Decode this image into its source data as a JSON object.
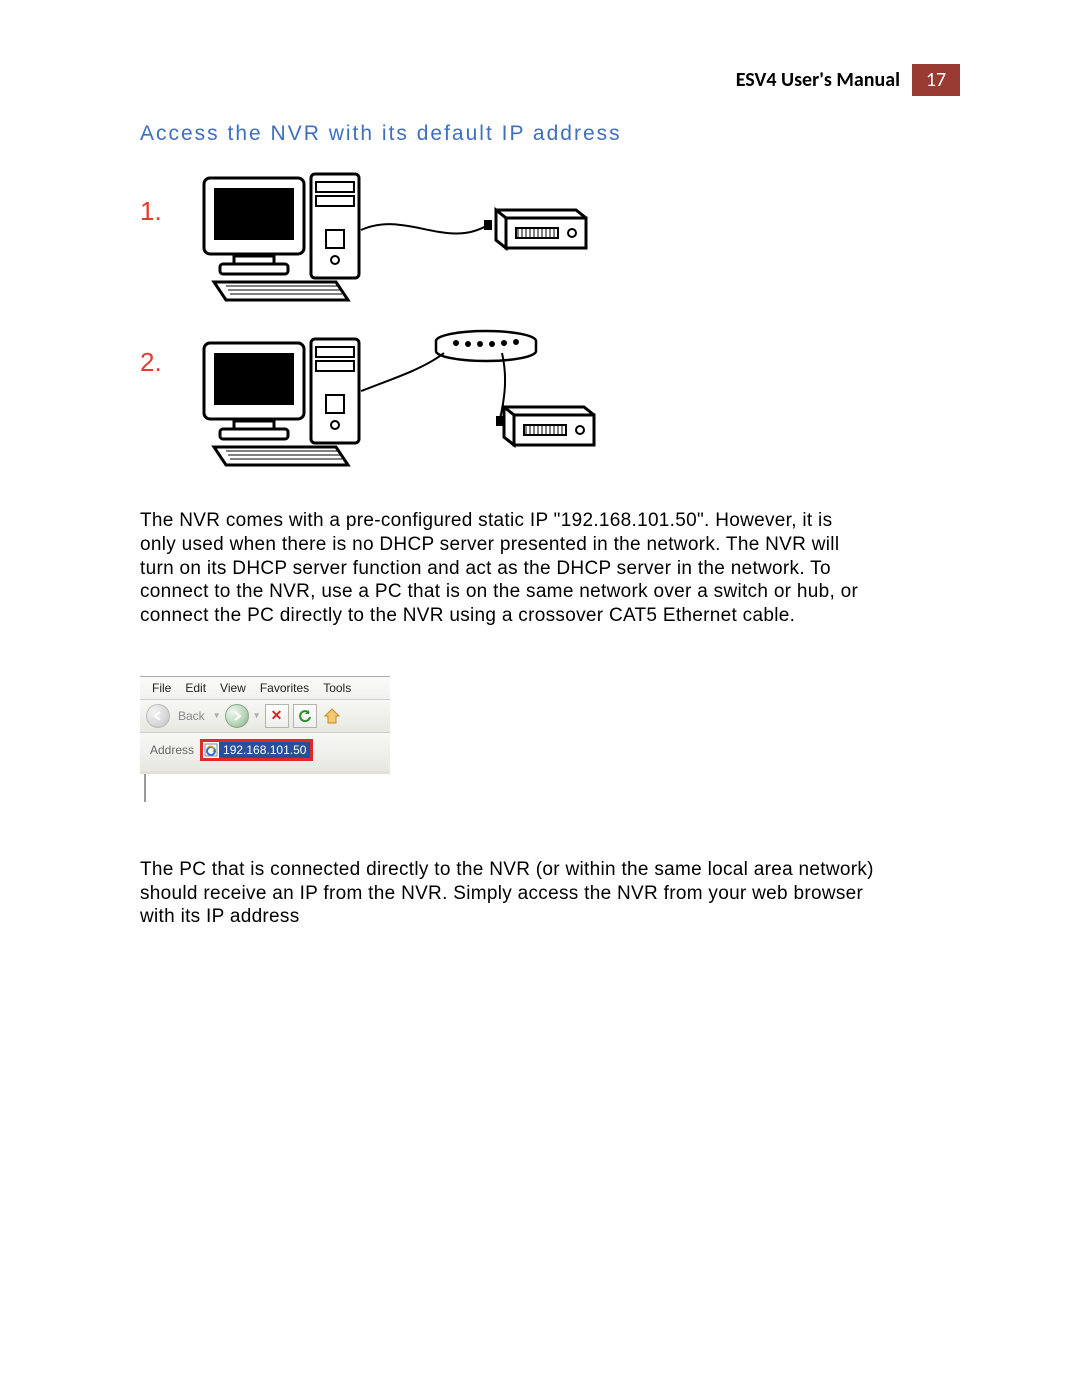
{
  "header": {
    "title": "ESV4 User's Manual",
    "page_number": "17"
  },
  "section_heading": "Access the NVR with its default IP address",
  "diagram_numbers": [
    "1.",
    "2."
  ],
  "paragraph1": "The NVR comes with a pre-configured static IP \"192.168.101.50\". However, it is only used when there is no DHCP server presented in the network. The NVR will turn on its DHCP server function and act as the DHCP server in the network. To connect to the NVR, use a PC that is on the same network over a switch or hub, or connect the PC directly to the NVR using a crossover CAT5 Ethernet cable.",
  "browser": {
    "menu": [
      "File",
      "Edit",
      "View",
      "Favorites",
      "Tools"
    ],
    "back_label": "Back",
    "address_label": "Address",
    "address_value": "192.168.101.50"
  },
  "paragraph2": "The PC that is connected directly to the NVR (or within the same local area network) should receive an IP from the NVR. Simply access the NVR from your web browser with its IP address"
}
